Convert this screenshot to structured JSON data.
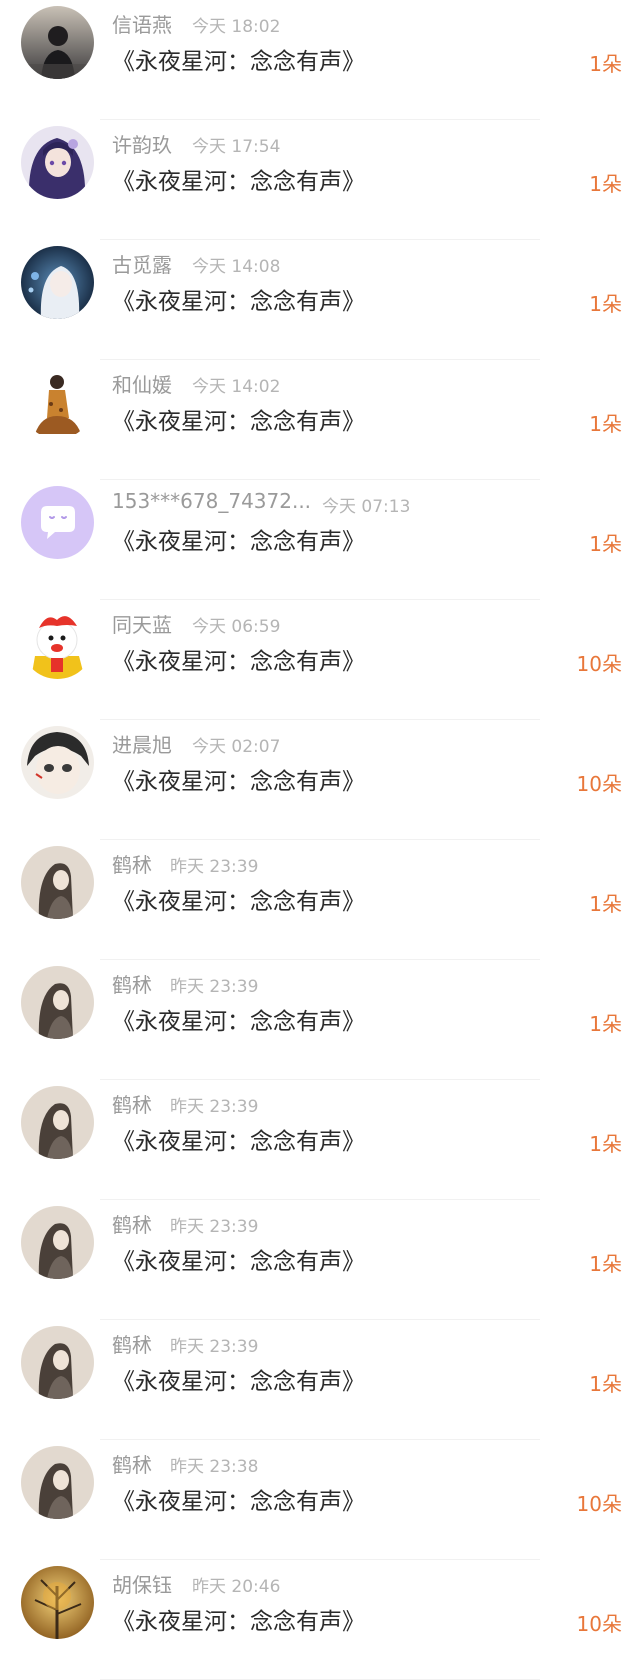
{
  "gift_list": {
    "items": [
      {
        "user": "信语燕",
        "time": "今天 18:02",
        "title": "《永夜星河：念念有声》",
        "count": "1朵",
        "avatar_icon": "photo-avatar-icon"
      },
      {
        "user": "许韵玖",
        "time": "今天 17:54",
        "title": "《永夜星河：念念有声》",
        "count": "1朵",
        "avatar_icon": "anime-avatar-icon"
      },
      {
        "user": "古觅露",
        "time": "今天 14:08",
        "title": "《永夜星河：念念有声》",
        "count": "1朵",
        "avatar_icon": "anime-avatar-icon"
      },
      {
        "user": "和仙媛",
        "time": "今天 14:02",
        "title": "《永夜星河：念念有声》",
        "count": "1朵",
        "avatar_icon": "photo-avatar-icon"
      },
      {
        "user": "153***678_74372...",
        "time": "今天 07:13",
        "title": "《永夜星河：念念有声》",
        "count": "1朵",
        "avatar_icon": "default-chat-avatar-icon"
      },
      {
        "user": "同天蓝",
        "time": "今天 06:59",
        "title": "《永夜星河：念念有声》",
        "count": "10朵",
        "avatar_icon": "cartoon-avatar-icon"
      },
      {
        "user": "进晨旭",
        "time": "今天 02:07",
        "title": "《永夜星河：念念有声》",
        "count": "10朵",
        "avatar_icon": "anime-avatar-icon"
      },
      {
        "user": "鹤秫",
        "time": "昨天 23:39",
        "title": "《永夜星河：念念有声》",
        "count": "1朵",
        "avatar_icon": "photo-avatar-icon"
      },
      {
        "user": "鹤秫",
        "time": "昨天 23:39",
        "title": "《永夜星河：念念有声》",
        "count": "1朵",
        "avatar_icon": "photo-avatar-icon"
      },
      {
        "user": "鹤秫",
        "time": "昨天 23:39",
        "title": "《永夜星河：念念有声》",
        "count": "1朵",
        "avatar_icon": "photo-avatar-icon"
      },
      {
        "user": "鹤秫",
        "time": "昨天 23:39",
        "title": "《永夜星河：念念有声》",
        "count": "1朵",
        "avatar_icon": "photo-avatar-icon"
      },
      {
        "user": "鹤秫",
        "time": "昨天 23:39",
        "title": "《永夜星河：念念有声》",
        "count": "1朵",
        "avatar_icon": "photo-avatar-icon"
      },
      {
        "user": "鹤秫",
        "time": "昨天 23:38",
        "title": "《永夜星河：念念有声》",
        "count": "10朵",
        "avatar_icon": "photo-avatar-icon"
      },
      {
        "user": "胡保钰",
        "time": "昨天 20:46",
        "title": "《永夜星河：念念有声》",
        "count": "10朵",
        "avatar_icon": "photo-avatar-icon"
      }
    ]
  },
  "colors": {
    "count_accent": "#e8773a",
    "name_text": "#9a9a9a",
    "time_text": "#b5b5b5",
    "title_text": "#2b2b2b",
    "divider": "#f1f1f1"
  }
}
